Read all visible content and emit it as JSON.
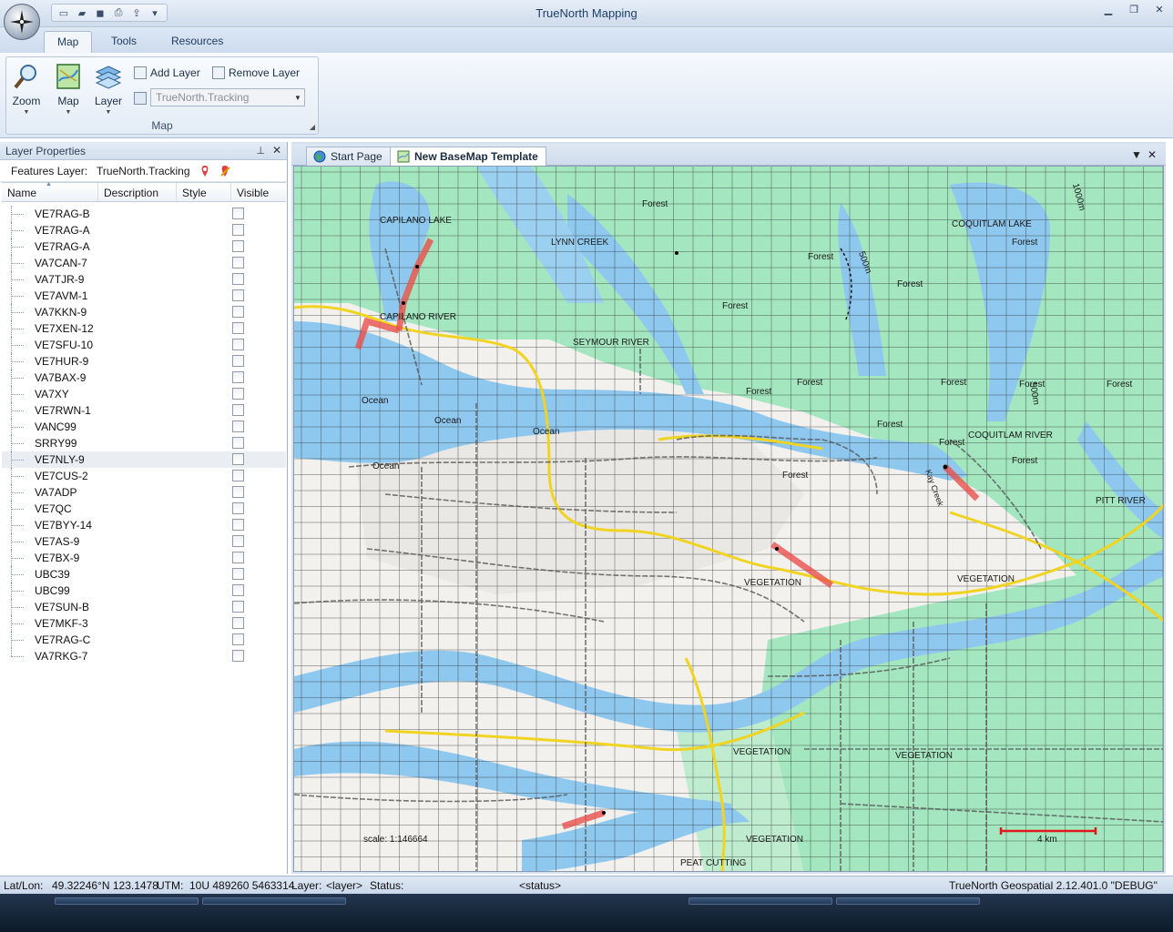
{
  "window": {
    "title": "TrueNorth Mapping"
  },
  "quick_access": {
    "icons": [
      "new-icon",
      "open-icon",
      "save-icon",
      "print-icon",
      "export-icon"
    ]
  },
  "ribbon": {
    "tabs": [
      {
        "label": "Map",
        "active": true
      },
      {
        "label": "Tools",
        "active": false
      },
      {
        "label": "Resources",
        "active": false
      }
    ],
    "group_label": "Map",
    "zoom_label": "Zoom",
    "map_label": "Map",
    "layer_label": "Layer",
    "add_layer_label": "Add Layer",
    "remove_layer_label": "Remove Layer",
    "layer_combo_value": "TrueNorth.Tracking"
  },
  "layer_panel": {
    "title": "Layer Properties",
    "features_label": "Features Layer:",
    "features_value": "TrueNorth.Tracking",
    "columns": {
      "name": "Name",
      "description": "Description",
      "style": "Style",
      "visible": "Visible"
    },
    "layers": [
      "VE7RAG-B",
      "VE7RAG-A",
      "VE7RAG-A",
      "VA7CAN-7",
      "VA7TJR-9",
      "VE7AVM-1",
      "VA7KKN-9",
      "VE7XEN-12",
      "VE7SFU-10",
      "VE7HUR-9",
      "VA7BAX-9",
      "VA7XY",
      "VE7RWN-1",
      "VANC99",
      "SRRY99",
      "VE7NLY-9",
      "VE7CUS-2",
      "VA7ADP",
      "VE7QC",
      "VE7BYY-14",
      "VE7AS-9",
      "VE7BX-9",
      "UBC39",
      "UBC99",
      "VE7SUN-B",
      "VE7MKF-3",
      "VE7RAG-C",
      "VA7RKG-7"
    ],
    "selected_index": 15
  },
  "documents": {
    "tabs": [
      {
        "label": "Start Page",
        "active": false
      },
      {
        "label": "New BaseMap Template",
        "active": true
      }
    ]
  },
  "map": {
    "labels": {
      "capilano_lake": "CAPILANO LAKE",
      "lynn_creek": "LYNN CREEK",
      "coquitlam_lake": "COQUITLAM LAKE",
      "capilano_river": "CAPILANO RIVER",
      "seymour_river": "SEYMOUR RIVER",
      "coquitlam_river": "COQUITLAM RIVER",
      "pitt_river": "PITT RIVER",
      "ocean": "Ocean",
      "forest": "Forest",
      "vegetation": "VEGETATION",
      "peat_cutting": "PEAT CUTTING",
      "contour_500": "500m",
      "contour_1000": "1000m",
      "creek": "Kay Creek",
      "scale": "scale: 1:146664",
      "scale_bar": "4 km"
    },
    "colors": {
      "water": "#8fc8ef",
      "forest": "#a3e6bf",
      "land": "#f2f1ee",
      "track": "#e8504e",
      "highway": "#f0d421"
    }
  },
  "status": {
    "latlon_label": "Lat/Lon:",
    "latlon_value": "49.32246°N 123.1478",
    "utm_label": "UTM:",
    "utm_value": "10U 489260 5463314",
    "layer_label": "Layer:",
    "layer_value": "<layer>",
    "status_label": "Status:",
    "status_value": "<status>",
    "version": "TrueNorth Geospatial 2.12.401.0 \"DEBUG\""
  }
}
